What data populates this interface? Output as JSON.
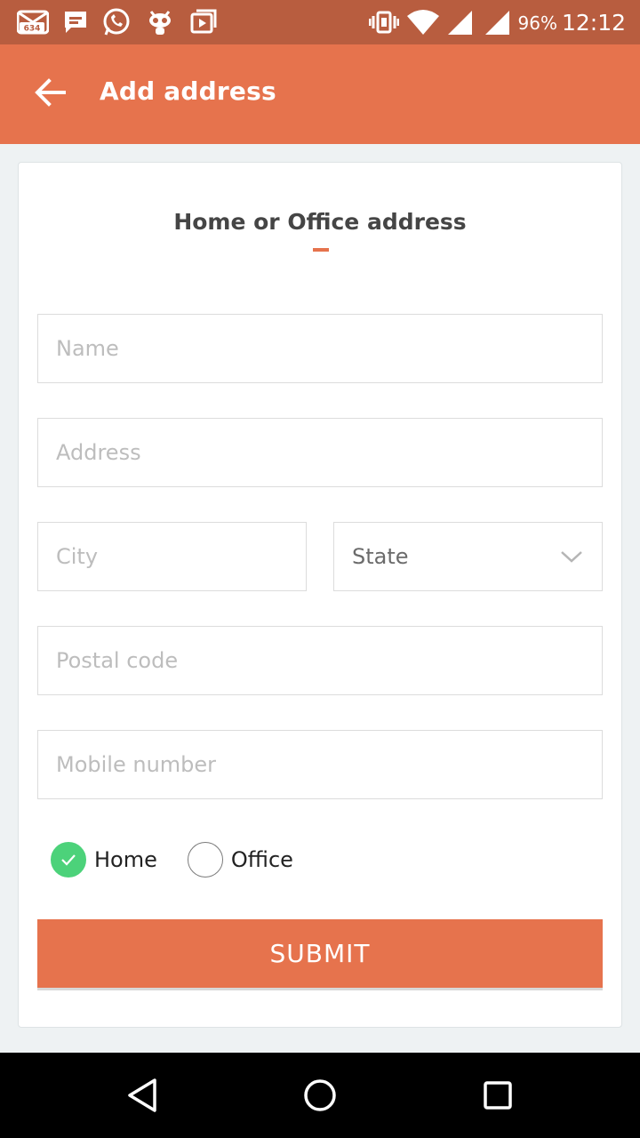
{
  "status_bar": {
    "notification_count": "634",
    "battery": "96%",
    "time": "12:12",
    "icons": [
      "mail-icon",
      "message-icon",
      "whatsapp-icon",
      "bug-icon",
      "media-icon",
      "vibrate-icon",
      "wifi-icon",
      "signal-icon",
      "signal-icon"
    ]
  },
  "app_bar": {
    "title": "Add address",
    "back_icon": "arrow-back-icon"
  },
  "form": {
    "title": "Home or Office address",
    "name_placeholder": "Name",
    "address_placeholder": "Address",
    "city_placeholder": "City",
    "state_value": "State",
    "postal_placeholder": "Postal code",
    "mobile_placeholder": "Mobile number",
    "address_type": {
      "options": [
        "Home",
        "Office"
      ],
      "selected": "Home"
    },
    "submit_label": "SUBMIT"
  },
  "nav_bar": {
    "icons": [
      "back-triangle-icon",
      "home-circle-icon",
      "recents-square-icon"
    ]
  },
  "colors": {
    "accent": "#e6734d",
    "status_bar": "#b85d3f",
    "checked": "#4cd27a"
  }
}
